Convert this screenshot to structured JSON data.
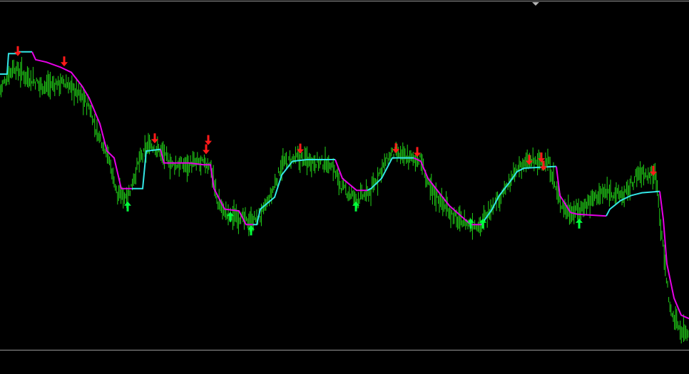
{
  "colors": {
    "background": "#000000",
    "frame": "#9a9a9a",
    "price_bars": "#22d318",
    "trend_down_line": "#e600e6",
    "trend_up_line": "#33e6e6",
    "sell_arrow": "#ff1a1a",
    "buy_arrow": "#00ff3c",
    "scroll_marker": "#b4b4b4"
  },
  "chart_data": {
    "type": "line",
    "title": "",
    "xlabel": "",
    "ylabel": "",
    "grid": false,
    "legend": "none",
    "x_range": [
      0,
      966
    ],
    "y_range": [
      0,
      1000
    ],
    "price_bars": {
      "name": "",
      "points": [
        [
          0,
          780
        ],
        [
          18,
          845
        ],
        [
          40,
          815
        ],
        [
          60,
          790
        ],
        [
          90,
          800
        ],
        [
          110,
          770
        ],
        [
          125,
          730
        ],
        [
          135,
          660
        ],
        [
          150,
          600
        ],
        [
          165,
          470
        ],
        [
          180,
          470
        ],
        [
          195,
          570
        ],
        [
          210,
          620
        ],
        [
          225,
          600
        ],
        [
          240,
          560
        ],
        [
          260,
          560
        ],
        [
          280,
          565
        ],
        [
          295,
          560
        ],
        [
          305,
          450
        ],
        [
          320,
          410
        ],
        [
          335,
          410
        ],
        [
          350,
          390
        ],
        [
          365,
          410
        ],
        [
          380,
          470
        ],
        [
          395,
          560
        ],
        [
          415,
          580
        ],
        [
          440,
          570
        ],
        [
          465,
          560
        ],
        [
          480,
          490
        ],
        [
          500,
          460
        ],
        [
          520,
          480
        ],
        [
          535,
          550
        ],
        [
          550,
          595
        ],
        [
          570,
          580
        ],
        [
          590,
          575
        ],
        [
          600,
          500
        ],
        [
          620,
          450
        ],
        [
          640,
          400
        ],
        [
          660,
          385
        ],
        [
          675,
          385
        ],
        [
          690,
          440
        ],
        [
          710,
          490
        ],
        [
          730,
          560
        ],
        [
          750,
          570
        ],
        [
          770,
          560
        ],
        [
          785,
          450
        ],
        [
          800,
          420
        ],
        [
          815,
          430
        ],
        [
          835,
          470
        ],
        [
          855,
          480
        ],
        [
          875,
          470
        ],
        [
          895,
          535
        ],
        [
          920,
          530
        ],
        [
          930,
          310
        ],
        [
          940,
          130
        ],
        [
          955,
          75
        ],
        [
          966,
          70
        ]
      ]
    },
    "trend_line": {
      "name": "",
      "segments": [
        {
          "direction": "up",
          "points": [
            [
              0,
              825
            ],
            [
              10,
              825
            ],
            [
              12,
              885
            ],
            [
              25,
              885
            ],
            [
              27,
              890
            ],
            [
              45,
              890
            ]
          ]
        },
        {
          "direction": "down",
          "points": [
            [
              45,
              890
            ],
            [
              50,
              867
            ],
            [
              65,
              860
            ],
            [
              85,
              845
            ],
            [
              100,
              830
            ],
            [
              115,
              790
            ],
            [
              125,
              755
            ],
            [
              130,
              730
            ],
            [
              140,
              680
            ],
            [
              150,
              600
            ],
            [
              160,
              580
            ],
            [
              170,
              490
            ],
            [
              185,
              490
            ]
          ]
        },
        {
          "direction": "up",
          "points": [
            [
              185,
              490
            ],
            [
              200,
              490
            ],
            [
              205,
              600
            ],
            [
              225,
              605
            ]
          ]
        },
        {
          "direction": "down",
          "points": [
            [
              225,
              605
            ],
            [
              230,
              565
            ],
            [
              265,
              565
            ],
            [
              285,
              560
            ],
            [
              295,
              560
            ],
            [
              300,
              490
            ],
            [
              315,
              430
            ],
            [
              335,
              425
            ],
            [
              345,
              385
            ],
            [
              355,
              385
            ]
          ]
        },
        {
          "direction": "up",
          "points": [
            [
              355,
              385
            ],
            [
              360,
              385
            ],
            [
              365,
              430
            ],
            [
              385,
              465
            ],
            [
              395,
              530
            ],
            [
              410,
              570
            ],
            [
              430,
              575
            ],
            [
              470,
              575
            ]
          ]
        },
        {
          "direction": "down",
          "points": [
            [
              470,
              575
            ],
            [
              480,
              520
            ],
            [
              500,
              485
            ],
            [
              515,
              485
            ]
          ]
        },
        {
          "direction": "up",
          "points": [
            [
              515,
              485
            ],
            [
              520,
              490
            ],
            [
              535,
              520
            ],
            [
              550,
              580
            ],
            [
              565,
              580
            ],
            [
              580,
              580
            ]
          ]
        },
        {
          "direction": "down",
          "points": [
            [
              580,
              580
            ],
            [
              590,
              570
            ],
            [
              600,
              520
            ],
            [
              615,
              480
            ],
            [
              630,
              440
            ],
            [
              660,
              385
            ],
            [
              675,
              385
            ]
          ]
        },
        {
          "direction": "up",
          "points": [
            [
              675,
              385
            ],
            [
              690,
              430
            ],
            [
              700,
              470
            ],
            [
              715,
              510
            ],
            [
              725,
              540
            ],
            [
              735,
              550
            ],
            [
              780,
              555
            ]
          ]
        },
        {
          "direction": "down",
          "points": [
            [
              780,
              555
            ],
            [
              785,
              470
            ],
            [
              800,
              420
            ],
            [
              810,
              415
            ],
            [
              850,
              410
            ]
          ]
        },
        {
          "direction": "up",
          "points": [
            [
              850,
              410
            ],
            [
              855,
              430
            ],
            [
              870,
              455
            ],
            [
              885,
              470
            ],
            [
              900,
              478
            ],
            [
              925,
              482
            ]
          ]
        },
        {
          "direction": "down",
          "points": [
            [
              925,
              482
            ],
            [
              930,
              400
            ],
            [
              935,
              270
            ],
            [
              945,
              170
            ],
            [
              955,
              120
            ],
            [
              966,
              110
            ]
          ]
        }
      ]
    },
    "signals": [
      {
        "type": "sell",
        "x": 25,
        "y": 890
      },
      {
        "type": "sell",
        "x": 90,
        "y": 860
      },
      {
        "type": "sell",
        "x": 217,
        "y": 635
      },
      {
        "type": "sell",
        "x": 292,
        "y": 630
      },
      {
        "type": "sell",
        "x": 289,
        "y": 603
      },
      {
        "type": "sell",
        "x": 421,
        "y": 605
      },
      {
        "type": "sell",
        "x": 555,
        "y": 606
      },
      {
        "type": "sell",
        "x": 585,
        "y": 595
      },
      {
        "type": "sell",
        "x": 742,
        "y": 572
      },
      {
        "type": "sell",
        "x": 759,
        "y": 579
      },
      {
        "type": "sell",
        "x": 762,
        "y": 555
      },
      {
        "type": "sell",
        "x": 916,
        "y": 540
      },
      {
        "type": "buy",
        "x": 179,
        "y": 440
      },
      {
        "type": "buy",
        "x": 323,
        "y": 410
      },
      {
        "type": "buy",
        "x": 352,
        "y": 370
      },
      {
        "type": "buy",
        "x": 499,
        "y": 440
      },
      {
        "type": "buy",
        "x": 660,
        "y": 390
      },
      {
        "type": "buy",
        "x": 677,
        "y": 390
      },
      {
        "type": "buy",
        "x": 812,
        "y": 390
      }
    ]
  }
}
